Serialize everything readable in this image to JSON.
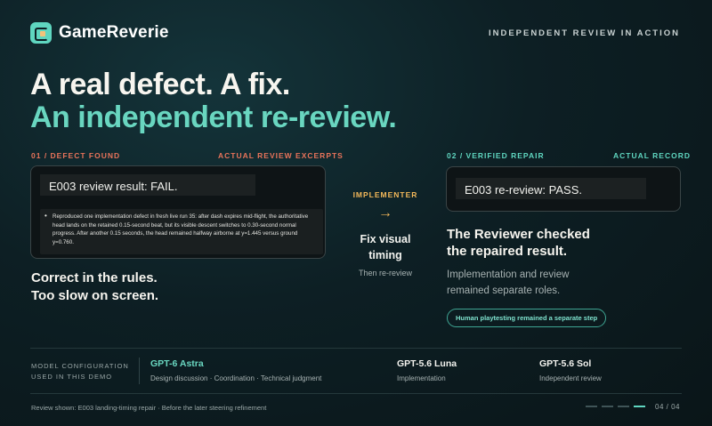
{
  "brand": {
    "name": "GameReverie",
    "tag": "INDEPENDENT REVIEW IN ACTION"
  },
  "headline": {
    "line1": "A real defect. A fix.",
    "line2": "An independent re-review."
  },
  "left": {
    "label": "01 / DEFECT FOUND",
    "label_right": "ACTUAL REVIEW EXCERPTS",
    "result": "E003 review result: FAIL.",
    "bullet": "Reproduced one implementation defect in fresh live run 35: after dash expires mid-flight, the authoritative head lands on the retained 0.15-second beat, but its visible descent switches to 0.30-second normal progress. After another 0.15 seconds, the head remained halfway airborne at y=1.445 versus ground y=0.760.",
    "summary_line1": "Correct in the rules.",
    "summary_line2": "Too slow on screen."
  },
  "middle": {
    "label": "IMPLEMENTER",
    "arrow": "→",
    "action_line1": "Fix visual",
    "action_line2": "timing",
    "then": "Then re-review"
  },
  "right": {
    "label": "02 / VERIFIED REPAIR",
    "label_right": "ACTUAL RECORD",
    "result": "E003 re-review: PASS.",
    "summary_line1": "The Reviewer checked",
    "summary_line2": "the repaired result.",
    "detail_line1": "Implementation and review",
    "detail_line2": "remained separate roles.",
    "pill": "Human playtesting remained a separate step"
  },
  "config": {
    "label_line1": "MODEL CONFIGURATION",
    "label_line2": "USED IN THIS DEMO",
    "models": [
      {
        "name": "GPT-6 Astra",
        "desc": "Design discussion · Coordination · Technical judgment",
        "color": "#69d6c0"
      },
      {
        "name": "GPT-5.6 Luna",
        "desc": "Implementation",
        "color": "#f2f2ee"
      },
      {
        "name": "GPT-5.6 Sol",
        "desc": "Independent review",
        "color": "#f2f2ee"
      }
    ]
  },
  "footer": {
    "note": "Review shown: E003 landing-timing repair · Before the later steering refinement",
    "page": "04 / 04"
  },
  "colors": {
    "accent": "#5fd6c0",
    "fail": "#e8735a",
    "implementer": "#f4b95a",
    "background": "#0d1f24"
  }
}
